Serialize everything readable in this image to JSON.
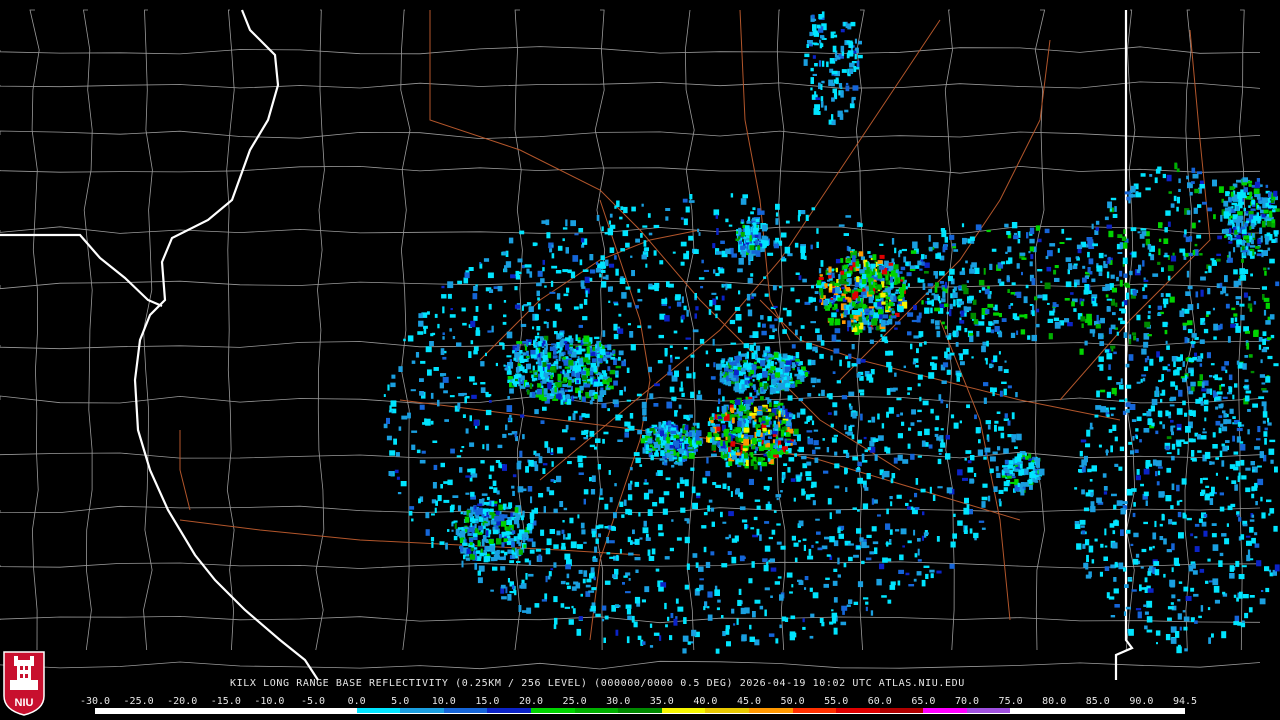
{
  "caption": "KILX LONG RANGE BASE REFLECTIVITY (0.25KM / 256 LEVEL) (000000/0000 0.5 DEG) 2026-04-19 10:02 UTC  ATLAS.NIU.EDU",
  "logo": {
    "text": "NIU",
    "icon": "university-seal-icon",
    "color": "#c8102e"
  },
  "colorbar": {
    "labels": [
      "-30.0",
      "-25.0",
      "-20.0",
      "-15.0",
      "-10.0",
      "-5.0",
      "0.0",
      "5.0",
      "10.0",
      "15.0",
      "20.0",
      "25.0",
      "30.0",
      "35.0",
      "40.0",
      "45.0",
      "50.0",
      "55.0",
      "60.0",
      "65.0",
      "70.0",
      "75.0",
      "80.0",
      "85.0",
      "90.0",
      "94.5"
    ],
    "colors": [
      "#ffffff",
      "#ffffff",
      "#ffffff",
      "#ffffff",
      "#ffffff",
      "#ffffff",
      "#00e5ff",
      "#1a9fe0",
      "#1565d8",
      "#0b23c8",
      "#00d400",
      "#00b000",
      "#008a00",
      "#f5f500",
      "#e8c800",
      "#ff9800",
      "#ff3000",
      "#e00000",
      "#b00000",
      "#ff00ff",
      "#a050e0",
      "#ffffff",
      "#ffffff",
      "#ffffff",
      "#ffffff"
    ]
  },
  "map": {
    "radar_site": "KILX",
    "colors": {
      "state_border": "#ffffff",
      "county_border": "#9a9a9a",
      "highway": "#b3562b",
      "background": "#000000"
    }
  }
}
